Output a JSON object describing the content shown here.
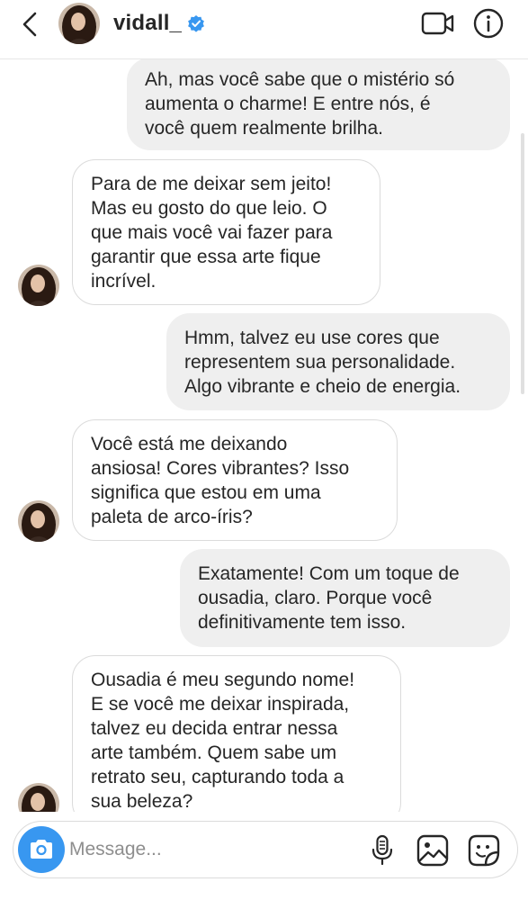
{
  "header": {
    "username": "vidall_",
    "verified": true,
    "icons": [
      "chevron-left-icon",
      "verified-badge-icon",
      "video-camera-icon",
      "info-icon"
    ]
  },
  "messages": [
    {
      "direction": "sent",
      "lines": [
        "Ah, mas você sabe que o mistério só",
        "aumenta o charme! E entre nós, é",
        "você quem realmente brilha."
      ]
    },
    {
      "direction": "received",
      "lines": [
        "Para de me deixar sem jeito!",
        "Mas eu gosto do que leio. O",
        "que mais você vai fazer para",
        "garantir que essa arte fique",
        "incrível."
      ]
    },
    {
      "direction": "sent",
      "lines": [
        "Hmm, talvez eu use cores que",
        "representem sua personalidade.",
        "Algo vibrante e cheio de energia."
      ]
    },
    {
      "direction": "received",
      "lines": [
        "Você está me deixando",
        "ansiosa! Cores vibrantes? Isso",
        "significa que estou em uma",
        "paleta de arco-íris?"
      ]
    },
    {
      "direction": "sent",
      "lines": [
        "Exatamente! Com um toque de",
        "ousadia, claro. Porque você",
        "definitivamente tem isso."
      ]
    },
    {
      "direction": "received",
      "lines": [
        "Ousadia é meu segundo nome!",
        "E se você me deixar inspirada,",
        "talvez eu decida entrar nessa",
        "arte também. Quem sabe um",
        "retrato seu, capturando toda a",
        "sua beleza?"
      ]
    }
  ],
  "composer": {
    "placeholder": "Message...",
    "icons": [
      "camera-icon",
      "microphone-icon",
      "gallery-icon",
      "sticker-icon"
    ]
  },
  "colors": {
    "accent": "#3897f0",
    "sent_bubble": "#efefef",
    "received_border": "#dbdbdb",
    "text": "#262626",
    "placeholder": "#8e8e8e"
  }
}
